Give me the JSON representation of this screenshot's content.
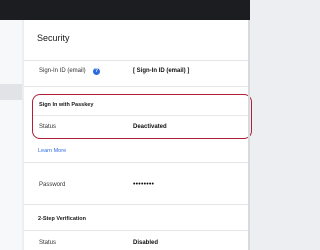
{
  "page": {
    "title": "Security"
  },
  "signin_id": {
    "label": "Sign-In ID (email)",
    "info_icon": "?",
    "value": "[ Sign-In ID (email) ]"
  },
  "passkey": {
    "heading": "Sign In with Passkey",
    "status_label": "Status",
    "status_value": "Deactivated",
    "learn_more": "Learn More"
  },
  "password": {
    "label": "Password",
    "value": "••••••••"
  },
  "two_step": {
    "heading": "2-Step Verification",
    "status_label": "Status",
    "status_value": "Disabled"
  },
  "colors": {
    "accent_border": "#b01f35",
    "link": "#2d6cdf",
    "topbar": "#1b1d21"
  }
}
